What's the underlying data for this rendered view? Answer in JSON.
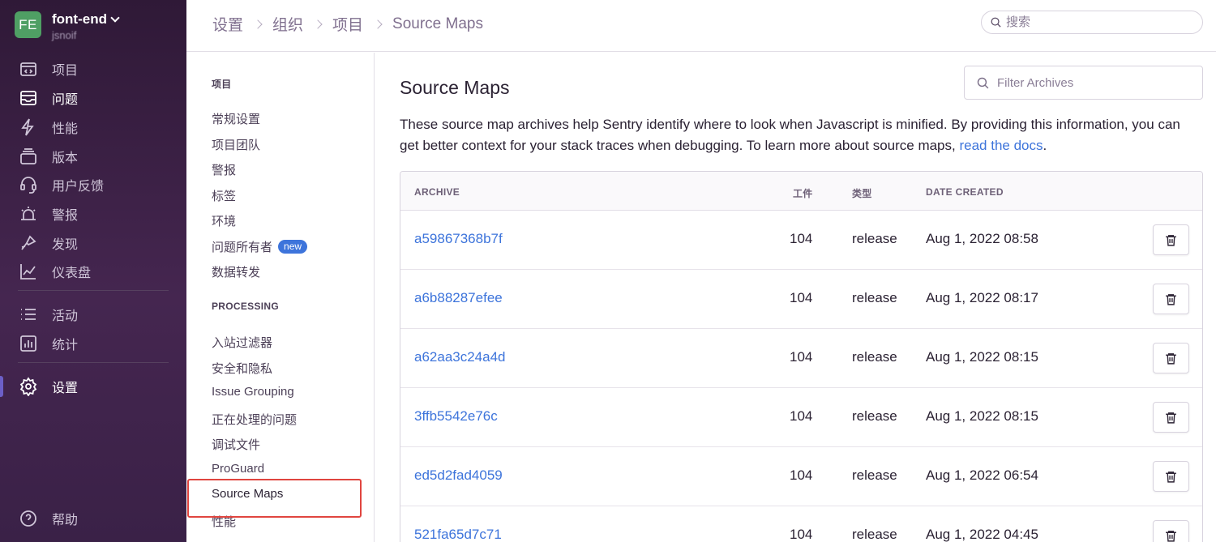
{
  "org": {
    "avatar": "FE",
    "name": "font-end",
    "user": "jsnoif"
  },
  "sidebar": {
    "items": [
      {
        "label": "项目",
        "icon": "projects-icon"
      },
      {
        "label": "问题",
        "icon": "issues-icon"
      },
      {
        "label": "性能",
        "icon": "performance-icon"
      },
      {
        "label": "版本",
        "icon": "releases-icon"
      },
      {
        "label": "用户反馈",
        "icon": "user-feedback-icon"
      },
      {
        "label": "警报",
        "icon": "alerts-icon"
      },
      {
        "label": "发现",
        "icon": "discover-icon"
      },
      {
        "label": "仪表盘",
        "icon": "dashboards-icon"
      },
      {
        "label": "活动",
        "icon": "activity-icon"
      },
      {
        "label": "统计",
        "icon": "stats-icon"
      },
      {
        "label": "设置",
        "icon": "settings-icon"
      },
      {
        "label": "帮助",
        "icon": "help-icon"
      }
    ]
  },
  "breadcrumb": [
    "设置",
    "组织",
    "项目",
    "Source Maps"
  ],
  "search": {
    "placeholder": "搜索"
  },
  "subnav": {
    "project_heading": "项目",
    "project_items": [
      "常规设置",
      "项目团队",
      "警报",
      "标签",
      "环境",
      "问题所有者",
      "数据转发"
    ],
    "new_badge": "new",
    "processing_heading": "PROCESSING",
    "processing_items": [
      "入站过滤器",
      "安全和隐私",
      "Issue Grouping",
      "正在处理的问题",
      "调试文件",
      "ProGuard",
      "Source Maps",
      "性能"
    ]
  },
  "main": {
    "title": "Source Maps",
    "filter_placeholder": "Filter Archives",
    "description": "These source map archives help Sentry identify where to look when Javascript is minified. By providing this information, you can get better context for your stack traces when debugging. To learn more about source maps, ",
    "docs_link": "read the docs",
    "docs_suffix": "."
  },
  "table": {
    "headers": {
      "archive": "ARCHIVE",
      "artifacts": "工件",
      "type": "类型",
      "date": "DATE CREATED"
    },
    "rows": [
      {
        "archive": "a59867368b7f",
        "count": "104",
        "type": "release",
        "date": "Aug 1, 2022 08:58"
      },
      {
        "archive": "a6b88287efee",
        "count": "104",
        "type": "release",
        "date": "Aug 1, 2022 08:17"
      },
      {
        "archive": "a62aa3c24a4d",
        "count": "104",
        "type": "release",
        "date": "Aug 1, 2022 08:15"
      },
      {
        "archive": "3ffb5542e76c",
        "count": "104",
        "type": "release",
        "date": "Aug 1, 2022 08:15"
      },
      {
        "archive": "ed5d2fad4059",
        "count": "104",
        "type": "release",
        "date": "Aug 1, 2022 06:54"
      },
      {
        "archive": "521fa65d7c71",
        "count": "104",
        "type": "release",
        "date": "Aug 1, 2022 04:45"
      }
    ]
  },
  "colors": {
    "sidebar": "#3a2147",
    "accent": "#6c5fc7",
    "link": "#3d74db",
    "highlight": "#e0453f",
    "badge": "#3d74db",
    "avatar": "#4f9f64"
  }
}
